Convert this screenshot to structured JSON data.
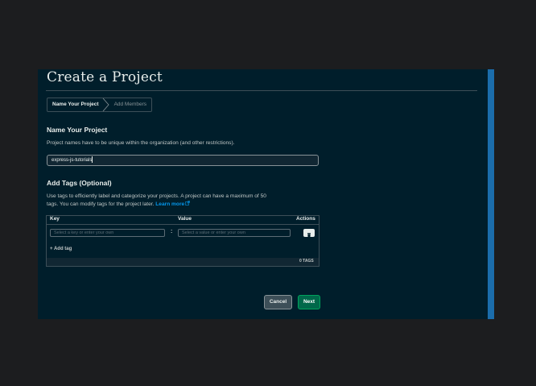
{
  "header": {
    "title": "Create a Project"
  },
  "steps": [
    {
      "label": "Name Your Project",
      "active": true
    },
    {
      "label": "Add Members",
      "active": false
    }
  ],
  "name_section": {
    "heading": "Name Your Project",
    "description": "Project names have to be unique within the organization (and other restrictions).",
    "input_value": "express-js-tutorials"
  },
  "tags_section": {
    "heading": "Add Tags (Optional)",
    "description_line1": "Use tags to efficiently label and categorize your projects. A project can have a maximum of 50",
    "description_line2": "tags. You can modify tags for the project later. ",
    "learn_more": "Learn more",
    "table": {
      "columns": [
        "Key",
        "Value",
        "Actions"
      ],
      "key_placeholder": "Select a key or enter your own",
      "value_placeholder": "Select a value or enter your own",
      "separator": ":",
      "add_tag_label": "+ Add tag",
      "count_label": "0 TAGS"
    }
  },
  "footer": {
    "cancel_label": "Cancel",
    "next_label": "Next"
  },
  "colors": {
    "panel_bg": "#001e2b",
    "accent_link": "#0498ec",
    "primary_button": "#00684a",
    "scrollbar": "#1b6dab"
  },
  "icons": [
    "chevron-right-icon",
    "external-link-icon",
    "trash-icon"
  ]
}
